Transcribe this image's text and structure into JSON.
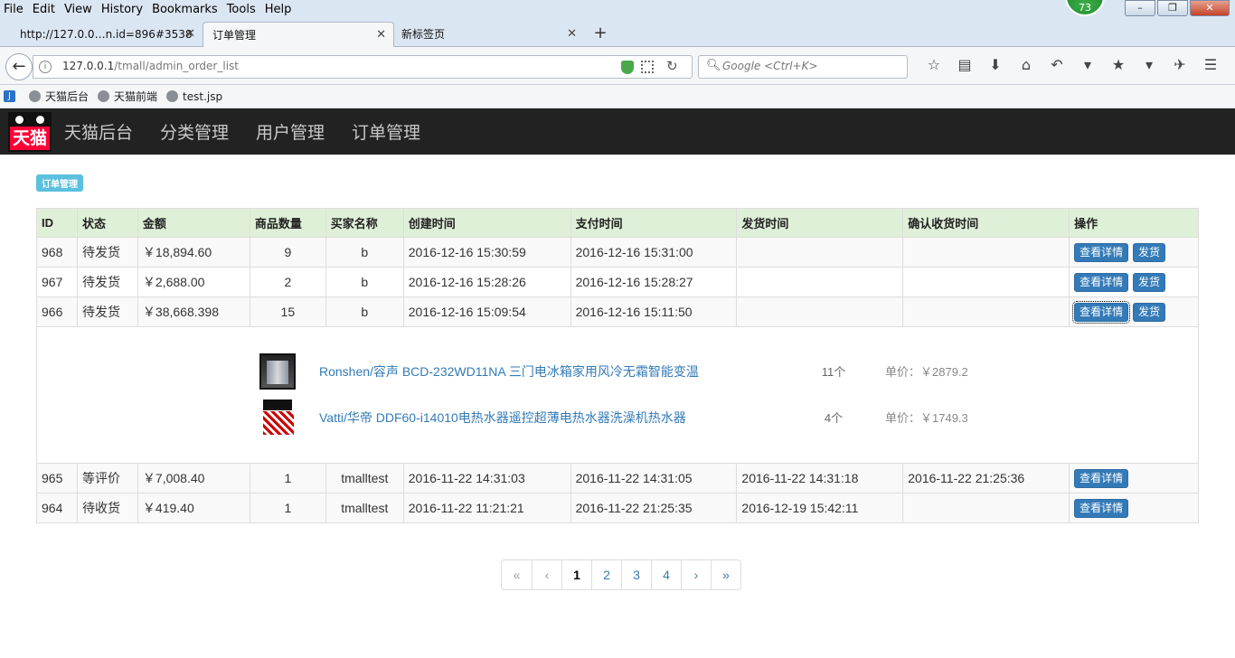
{
  "browser": {
    "menu": [
      "File",
      "Edit",
      "View",
      "History",
      "Bookmarks",
      "Tools",
      "Help"
    ],
    "badge_count": "73",
    "tabs": [
      {
        "title": "http://127.0.0…n.id=896#3538"
      },
      {
        "title": "订单管理"
      },
      {
        "title": "新标签页"
      }
    ],
    "new_tab": "+",
    "url_host": "127.0.0.1",
    "url_path": "/tmall/admin_order_list",
    "search_placeholder": "Google <Ctrl+K>",
    "bookmarks": [
      {
        "label": "天猫后台"
      },
      {
        "label": "天猫前端"
      },
      {
        "label": "test.jsp"
      }
    ]
  },
  "app": {
    "logo_text": "天猫",
    "brand": "天猫后台",
    "nav": [
      "分类管理",
      "用户管理",
      "订单管理"
    ]
  },
  "page": {
    "label": "订单管理",
    "columns": [
      "ID",
      "状态",
      "金额",
      "商品数量",
      "买家名称",
      "创建时间",
      "支付时间",
      "发货时间",
      "确认收货时间",
      "操作"
    ],
    "view_label": "查看详情",
    "ship_label": "发货",
    "rows_top": [
      {
        "id": "968",
        "status": "待发货",
        "amount": "￥18,894.60",
        "qty": "9",
        "buyer": "b",
        "created": "2016-12-16 15:30:59",
        "paid": "2016-12-16 15:31:00",
        "shipped": "",
        "confirmed": ""
      },
      {
        "id": "967",
        "status": "待发货",
        "amount": "￥2,688.00",
        "qty": "2",
        "buyer": "b",
        "created": "2016-12-16 15:28:26",
        "paid": "2016-12-16 15:28:27",
        "shipped": "",
        "confirmed": ""
      },
      {
        "id": "966",
        "status": "待发货",
        "amount": "￥38,668.398",
        "qty": "15",
        "buyer": "b",
        "created": "2016-12-16 15:09:54",
        "paid": "2016-12-16 15:11:50",
        "shipped": "",
        "confirmed": ""
      }
    ],
    "detail_items": [
      {
        "name": "Ronshen/容声 BCD-232WD11NA 三门电冰箱家用风冷无霜智能变温",
        "qty": "11个",
        "price": "单价：￥2879.2"
      },
      {
        "name": "Vatti/华帝 DDF60-i14010电热水器遥控超薄电热水器洗澡机热水器",
        "qty": "4个",
        "price": "单价：￥1749.3"
      }
    ],
    "rows_bottom": [
      {
        "id": "965",
        "status": "等评价",
        "amount": "￥7,008.40",
        "qty": "1",
        "buyer": "tmalltest",
        "created": "2016-11-22 14:31:03",
        "paid": "2016-11-22 14:31:05",
        "shipped": "2016-11-22 14:31:18",
        "confirmed": "2016-11-22 21:25:36"
      },
      {
        "id": "964",
        "status": "待收货",
        "amount": "￥419.40",
        "qty": "1",
        "buyer": "tmalltest",
        "created": "2016-11-22 11:21:21",
        "paid": "2016-11-22 21:25:35",
        "shipped": "2016-12-19 15:42:11",
        "confirmed": ""
      }
    ],
    "pagination": [
      "«",
      "‹",
      "1",
      "2",
      "3",
      "4",
      "›",
      "»"
    ]
  }
}
